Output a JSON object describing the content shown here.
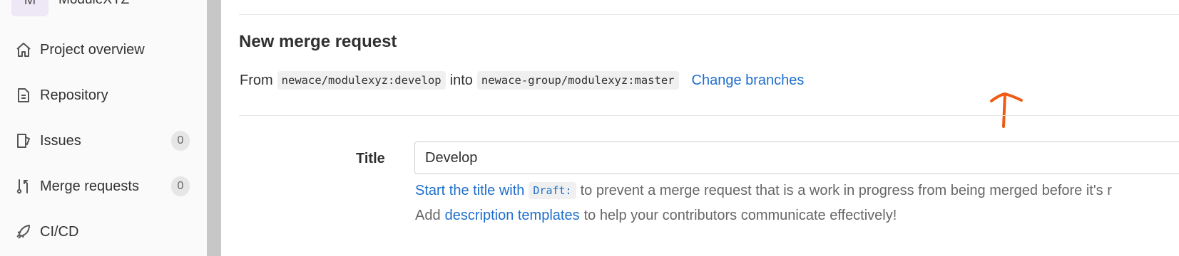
{
  "sidebar": {
    "project": {
      "avatar_letter": "M",
      "name": "ModuleXYZ"
    },
    "items": [
      {
        "label": "Project overview",
        "icon": "home-icon"
      },
      {
        "label": "Repository",
        "icon": "document-icon"
      },
      {
        "label": "Issues",
        "icon": "issues-icon",
        "count": "0"
      },
      {
        "label": "Merge requests",
        "icon": "merge-request-icon",
        "count": "0"
      },
      {
        "label": "CI/CD",
        "icon": "rocket-icon"
      }
    ]
  },
  "main": {
    "title": "New merge request",
    "branch_line": {
      "from_label": "From",
      "source": "newace/modulexyz:develop",
      "into_label": "into",
      "target": "newace-group/modulexyz:master",
      "change_link": "Change branches"
    },
    "form": {
      "title_label": "Title",
      "title_value": "Develop",
      "help_draft": {
        "link": "Start the title with",
        "code": "Draft:",
        "rest": "to prevent a merge request that is a work in progress from being merged before it's r"
      },
      "help_templates": {
        "prefix": "Add",
        "link": "description templates",
        "suffix": "to help your contributors communicate effectively!"
      }
    },
    "annotation": {
      "icon": "arrow-up-annotation",
      "color": "#f05a14"
    }
  },
  "colors": {
    "link": "#1f6ecc",
    "sidebar_bg": "#fafafa",
    "scrollbar": "#c7c7c7"
  }
}
